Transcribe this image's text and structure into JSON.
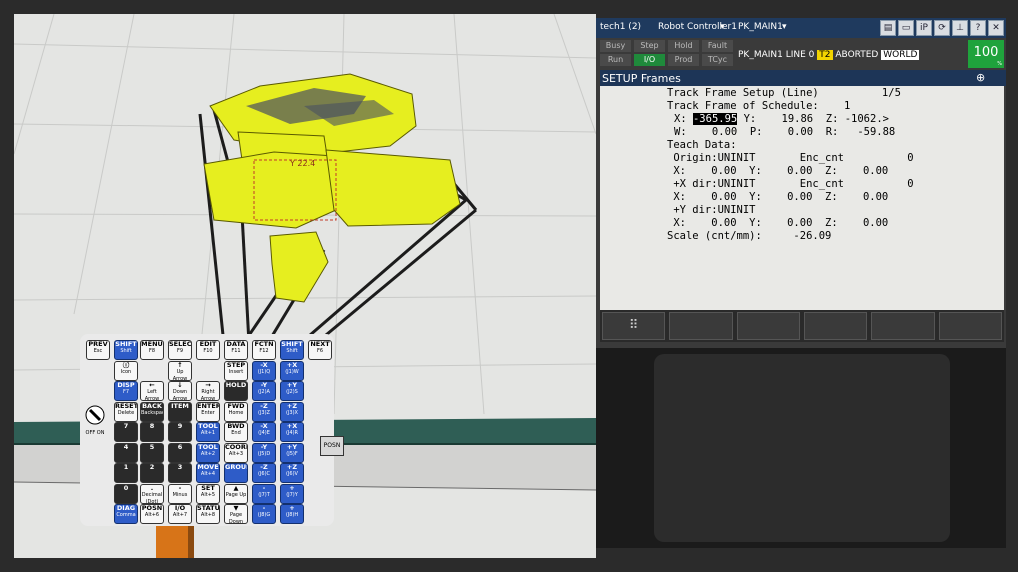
{
  "window": {
    "title": "tech1 (2)",
    "controller": "Robot Controller1",
    "program": "PK_MAIN1"
  },
  "topbar_icons": [
    "save-icon",
    "keyboard-icon",
    "ip-icon",
    "refresh-icon",
    "pendant-icon",
    "help-icon",
    "close-icon"
  ],
  "topbar_glyphs": [
    "▤",
    "▭",
    "iP",
    "⟳",
    "⊥",
    "?",
    "✕"
  ],
  "status": {
    "busy": "Busy",
    "step": "Step",
    "hold": "Hold",
    "fault": "Fault",
    "run": "Run",
    "io": "I/O",
    "prod": "Prod",
    "tcyc": "TCyc",
    "line": "PK_MAIN1 LINE 0",
    "t2": "T2",
    "state": "ABORTED",
    "frame": "WORLD",
    "override": "100",
    "override_unit": "%"
  },
  "screen": {
    "title": "SETUP Frames",
    "zoom_icon": "⊕",
    "page": "1/5",
    "lines": {
      "l1": "Track Frame Setup (Line)          1/5",
      "l2": "Track Frame of Schedule:    1",
      "l3a": "X:",
      "l3b": "-365.95",
      "l3c": " Y:    19.86  Z: -1062.>",
      "l4": "W:    0.00  P:    0.00  R:   -59.88",
      "l5": "Teach Data:",
      "l6": " Origin:UNINIT       Enc_cnt          0",
      "l7": " X:    0.00  Y:    0.00  Z:    0.00",
      "l8": " +X dir:UNINIT       Enc_cnt          0",
      "l9": " X:    0.00  Y:    0.00  Z:    0.00",
      "l10": " +Y dir:UNINIT",
      "l11": " X:    0.00  Y:    0.00  Z:    0.00",
      "l12": "Scale (cnt/mm):     -26.09"
    }
  },
  "fkeys": [
    "⠿",
    "",
    "",
    "",
    "",
    ""
  ],
  "keys": {
    "prev": [
      "PREV",
      "Esc"
    ],
    "shift_l": [
      "SHIFT",
      "Shift"
    ],
    "menu": [
      "MENU",
      "F8"
    ],
    "select": [
      "SELECT",
      "F9"
    ],
    "edit": [
      "EDIT",
      "F10"
    ],
    "data": [
      "DATA",
      "F11"
    ],
    "fctn": [
      "FCTN",
      "F12"
    ],
    "shift_r": [
      "SHIFT",
      "Shift"
    ],
    "next": [
      "NEXT",
      "F6"
    ],
    "icon": [
      "ⓘ",
      "Icon"
    ],
    "up": [
      "↑",
      "Up Arrow"
    ],
    "step": [
      "STEP",
      "Insert"
    ],
    "xm": [
      "-X",
      "(J1)Q"
    ],
    "xp": [
      "+X",
      "(J1)W"
    ],
    "disp": [
      "DISP",
      "F7"
    ],
    "left": [
      "←",
      "Left Arrow"
    ],
    "down": [
      "↓",
      "Down Arrow"
    ],
    "right": [
      "→",
      "Right Arrow"
    ],
    "hold": [
      "HOLD",
      ""
    ],
    "ym": [
      "-Y",
      "(J2)A"
    ],
    "yp": [
      "+Y",
      "(J2)S"
    ],
    "reset": [
      "RESET",
      "Delete"
    ],
    "back": [
      "BACK",
      "Backspace"
    ],
    "item": [
      "ITEM",
      ""
    ],
    "enter": [
      "ENTER",
      "Enter"
    ],
    "fwd": [
      "FWD",
      "Home"
    ],
    "zm": [
      "-Z",
      "(J3)Z"
    ],
    "zp": [
      "+Z",
      "(J3)X"
    ],
    "k7": [
      "7",
      ""
    ],
    "k8": [
      "8",
      ""
    ],
    "k9": [
      "9",
      ""
    ],
    "tool1": [
      "TOOL",
      "Alt+1"
    ],
    "bwd": [
      "BWD",
      "End"
    ],
    "j4m": [
      "-X",
      "(J4)E"
    ],
    "j4p": [
      "+X",
      "(J4)R"
    ],
    "k4": [
      "4",
      ""
    ],
    "k5": [
      "5",
      ""
    ],
    "k6": [
      "6",
      ""
    ],
    "tool2": [
      "TOOL",
      "Alt+2"
    ],
    "coord": [
      "COORD",
      "Alt+3"
    ],
    "j5m": [
      "-Y",
      "(J5)D"
    ],
    "j5p": [
      "+Y",
      "(J5)F"
    ],
    "k1": [
      "1",
      ""
    ],
    "k2": [
      "2",
      ""
    ],
    "k3": [
      "3",
      ""
    ],
    "move": [
      "MOVE",
      "Alt+4"
    ],
    "group": [
      "GROUP",
      ""
    ],
    "j6m": [
      "-Z",
      "(J6)C"
    ],
    "j6p": [
      "+Z",
      "(J6)V"
    ],
    "k0": [
      "0",
      ""
    ],
    "dot": [
      ".",
      "Decimal (Dot)"
    ],
    "minus": [
      "-",
      "Minus"
    ],
    "set": [
      "SET",
      "Alt+5"
    ],
    "pgup": [
      "▲",
      "Page Up"
    ],
    "j7m": [
      "-",
      "(J7)T"
    ],
    "j7p": [
      "+",
      "(J7)Y"
    ],
    "diag": [
      "DIAG",
      "Comma"
    ],
    "posn": [
      "POSN",
      "Alt+6"
    ],
    "io": [
      "I/O",
      "Alt+7"
    ],
    "status": [
      "STATUS",
      "Alt+8"
    ],
    "pgdn": [
      "▼",
      "Page Down"
    ],
    "j8m": [
      "-",
      "(J8)G"
    ],
    "j8p": [
      "+",
      "(J8)H"
    ]
  },
  "side_posn": "POSN",
  "dial_label": "OFF ON",
  "scene": {
    "coord_label": "Y 22.4"
  },
  "colors": {
    "titlebar": "#1f3a5e",
    "header": "#1d3557",
    "run_green": "#1f8a3b",
    "t2_yellow": "#f2d400",
    "robot_yellow": "#e6ee1f",
    "conveyor": "#2f5e55",
    "key_blue": "#2e5cc8"
  }
}
